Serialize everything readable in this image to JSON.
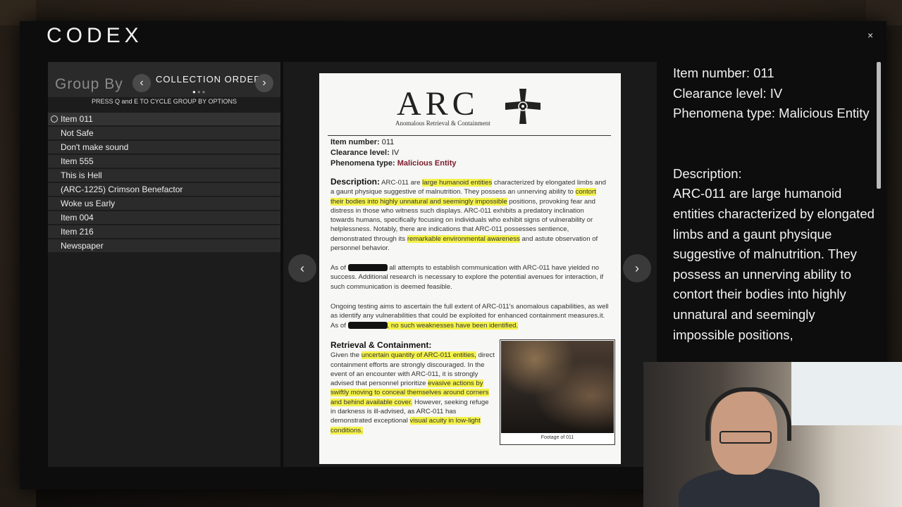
{
  "header": {
    "title": "CODEX",
    "close_glyph": "×"
  },
  "left_panel": {
    "groupby_label": "Group By",
    "collection_label": "COLLECTION ORDER",
    "hint": "PRESS Q and E TO CYCLE GROUP BY OPTIONS",
    "items": [
      "Item 011",
      "Not Safe",
      "Don't make sound",
      "Item 555",
      "This is Hell",
      "(ARC-1225) Crimson Benefactor",
      "Woke us Early",
      "Item 004",
      "Item 216",
      "Newspaper"
    ],
    "selected_index": 0
  },
  "document": {
    "logo_text": "ARC",
    "logo_sub": "Anomalous Retrieval & Containment",
    "item_number_label": "Item number:",
    "item_number_value": "011",
    "clearance_label": "Clearance level:",
    "clearance_value": "IV",
    "phenomena_label": "Phenomena type:",
    "phenomena_value": "Malicious Entity",
    "description_heading": "Description:",
    "desc_1": "ARC-011 are",
    "desc_hl_1": "large humanoid entities",
    "desc_2": "characterized by elongated limbs and a gaunt physique suggestive of malnutrition. They possess an unnerving ability to",
    "desc_hl_2": "contort their bodies into highly unnatural and seemingly impossible",
    "desc_3": "positions, provoking fear and distress in those who witness such displays. ARC-011 exhibits a predatory inclination towards humans, specifically focusing on individuals who exhibit signs of vulnerability or helplessness. Notably, there are indications that ARC-011 possesses sentience, demonstrated through its",
    "desc_hl_3": "remarkable environmental awareness",
    "desc_4": "and astute observation of personnel behavior.",
    "p2_a": "As of",
    "p2_b": "all attempts to establish communication with ARC-011 have yielded no success. Additional research is necessary to explore the potential avenues for interaction, if such communication is deemed feasible.",
    "p3_a": "Ongoing testing aims to ascertain the full extent of ARC-011's anomalous capabilities, as well as identify any vulnerabilities that could be exploited for enhanced containment measures.it. As of",
    "p3_hl": ", no such weaknesses have been identified.",
    "retrieval_heading": "Retrieval & Containment:",
    "r_1": "Given the",
    "r_hl_1": "uncertain quantity of ARC-011 entities,",
    "r_2": "direct containment efforts are strongly discouraged. In the event of an encounter with ARC-011, it is strongly advised that personnel prioritize",
    "r_hl_2": "evasive actions by swiftly moving to conceal themselves around corners and behind available cover.",
    "r_3": "However, seeking refuge in darkness is ill-advised, as ARC-011 has demonstrated exceptional",
    "r_hl_3": "visual acuity in low-light conditions.",
    "photo_caption": "Footage of 011"
  },
  "right_panel": {
    "item_number": "Item number: 011",
    "clearance": "Clearance level: IV",
    "phenomena": "Phenomena type: Malicious Entity",
    "description_label": "Description:",
    "description_text": "ARC-011 are large humanoid entities characterized by elongated limbs and a gaunt physique suggestive of malnutrition. They possess an unnerving ability to contort their bodies into highly unnatural and seemingly impossible positions,"
  },
  "nav": {
    "prev_glyph": "‹",
    "next_glyph": "›"
  },
  "colors": {
    "highlight": "#f4f24a",
    "malicious": "#7a1a2a"
  }
}
